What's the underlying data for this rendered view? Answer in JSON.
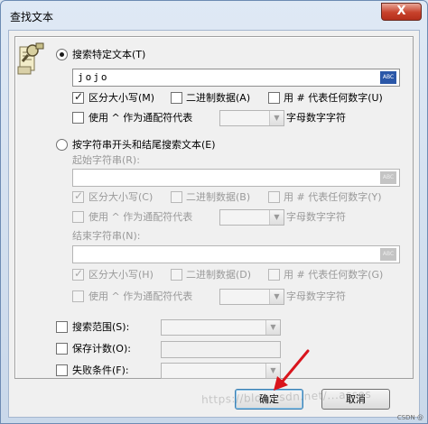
{
  "window": {
    "title": "查找文本",
    "close_glyph": "X"
  },
  "specific": {
    "radio_label": "搜索特定文本(T)",
    "value": "jojo",
    "abc_badge": "ABC",
    "case_label": "区分大小写(M)",
    "binary_label": "二进制数据(A)",
    "hash_label": "用 # 代表任何数字(U)",
    "caret_label": "使用 ^ 作为通配符代表",
    "alnum_label": "字母数字字符"
  },
  "ends": {
    "radio_label": "按字符串开头和结尾搜索文本(E)",
    "start_label": "起始字符串(R):",
    "start_case_label": "区分大小写(C)",
    "start_binary_label": "二进制数据(B)",
    "start_hash_label": "用 # 代表任何数字(Y)",
    "start_caret_label": "使用 ^ 作为通配符代表",
    "start_alnum_label": "字母数字字符",
    "end_label": "结束字符串(N):",
    "end_case_label": "区分大小写(H)",
    "end_binary_label": "二进制数据(D)",
    "end_hash_label": "用 # 代表任何数字(G)",
    "end_caret_label": "使用 ^ 作为通配符代表",
    "end_alnum_label": "字母数字字符"
  },
  "options": {
    "scope_label": "搜索范围(S):",
    "count_label": "保存计数(O):",
    "fail_label": "失败条件(F):"
  },
  "buttons": {
    "ok_label": "确定",
    "cancel_label": "取消"
  },
  "overlay": {
    "watermark": "https://blog.csdn.net/...asses",
    "corner": "CSDN @"
  },
  "colors": {
    "accent": "#2b57a8",
    "arrow": "#d9141c"
  },
  "icons": {
    "dialog": "find-text-icon",
    "checked": "checkmark-icon",
    "dropdown": "chevron-down-icon"
  }
}
